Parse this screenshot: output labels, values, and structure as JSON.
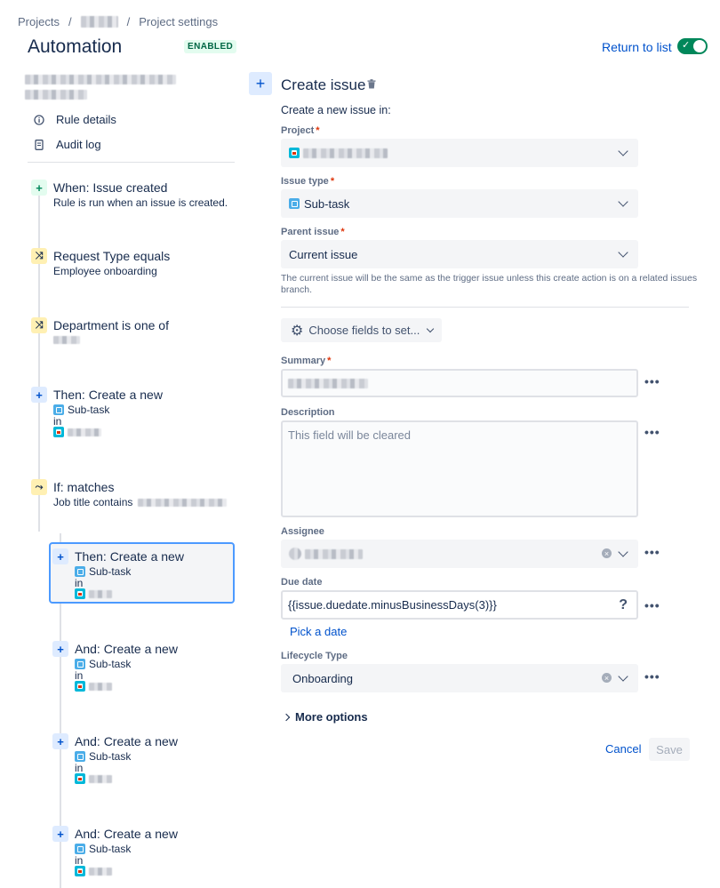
{
  "breadcrumb": {
    "projects": "Projects",
    "sep": "/",
    "settings": "Project settings"
  },
  "header": {
    "title": "Automation",
    "status_badge": "ENABLED",
    "return_link": "Return to list",
    "toggle_on": true
  },
  "sidebar": {
    "rule_details": "Rule details",
    "audit_log": "Audit log"
  },
  "steps": {
    "trigger": {
      "title": "When: Issue created",
      "desc": "Rule is run when an issue is created."
    },
    "cond1": {
      "title": "Request Type equals",
      "desc": "Employee onboarding"
    },
    "cond2": {
      "title": "Department is one of"
    },
    "action1": {
      "title": "Then: Create a new",
      "type": "Sub-task",
      "in": "in"
    },
    "ifblock": {
      "title": "If: matches",
      "desc": "Job title contains"
    },
    "nested1": {
      "title": "Then: Create a new",
      "type": "Sub-task",
      "in": "in"
    },
    "nested2": {
      "title": "And: Create a new",
      "type": "Sub-task",
      "in": "in"
    },
    "nested3": {
      "title": "And: Create a new",
      "type": "Sub-task",
      "in": "in"
    },
    "nested4": {
      "title": "And: Create a new",
      "type": "Sub-task",
      "in": "in"
    }
  },
  "form": {
    "title": "Create issue",
    "intro": "Create a new issue in:",
    "project_label": "Project",
    "issue_type_label": "Issue type",
    "issue_type_value": "Sub-task",
    "parent_label": "Parent issue",
    "parent_value": "Current issue",
    "parent_help": "The current issue will be the same as the trigger issue unless this create action is on a related issues branch.",
    "choose_fields": "Choose fields to set...",
    "summary_label": "Summary",
    "description_label": "Description",
    "description_placeholder": "This field will be cleared",
    "assignee_label": "Assignee",
    "due_label": "Due date",
    "due_value": "{{issue.duedate.minusBusinessDays(3)}}",
    "due_help_icon": "?",
    "pick_date": "Pick a date",
    "lifecycle_label": "Lifecycle Type",
    "lifecycle_value": "Onboarding",
    "more_options": "More options",
    "cancel": "Cancel",
    "save": "Save",
    "required_mark": "*",
    "more_dots": "•••"
  },
  "colors": {
    "accent": "#0052cc",
    "toggle": "#00875a",
    "selected_border": "#4c9aff"
  }
}
